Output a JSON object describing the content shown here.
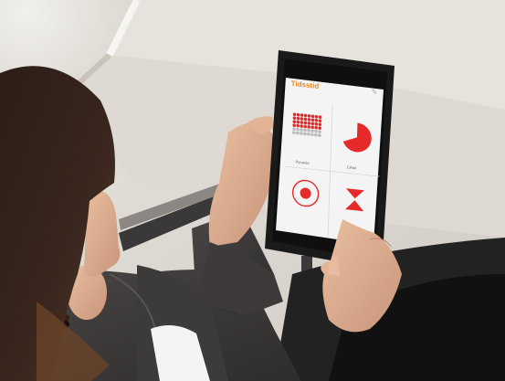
{
  "app": {
    "title": "Tidsstid",
    "menu_icon": "pencil-icon",
    "tiles": [
      {
        "label": "Pyramid",
        "icon": "dot-grid-icon"
      },
      {
        "label": "Cirkel",
        "icon": "pie-icon"
      },
      {
        "label": "",
        "icon": "target-icon"
      },
      {
        "label": "",
        "icon": "hourglass-icon"
      }
    ]
  },
  "colors": {
    "accent": "#e62a2a",
    "title": "#f08a1c",
    "screen_bg": "#f4f4f4"
  }
}
